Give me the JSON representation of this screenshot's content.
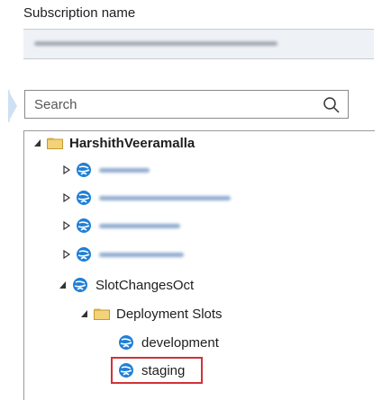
{
  "header": {
    "subscription_label": "Subscription name"
  },
  "search": {
    "placeholder": "Search"
  },
  "tree": {
    "root": {
      "label": "HarshithVeeramalla"
    },
    "app_slotchanges": {
      "label": "SlotChangesOct"
    },
    "folder_slots": {
      "label": "Deployment Slots"
    },
    "slot_development": {
      "label": "development"
    },
    "slot_staging": {
      "label": "staging"
    }
  },
  "colors": {
    "selection_border": "#d0323a",
    "folder": "#dcb85a",
    "app_icon": "#1f7fd6"
  },
  "icons": [
    "search-icon",
    "folder-icon",
    "app-service-icon",
    "expand-arrow-icon",
    "collapse-arrow-icon"
  ]
}
